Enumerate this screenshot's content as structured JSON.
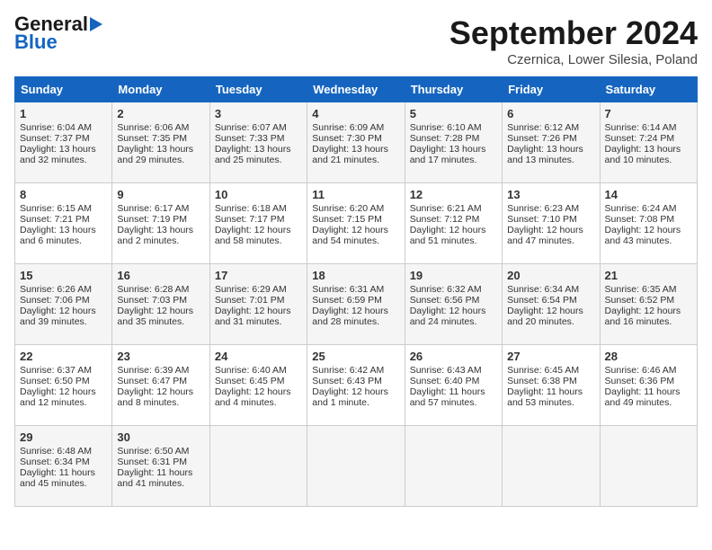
{
  "header": {
    "logo_line1": "General",
    "logo_line2": "Blue",
    "month_title": "September 2024",
    "subtitle": "Czernica, Lower Silesia, Poland"
  },
  "days_of_week": [
    "Sunday",
    "Monday",
    "Tuesday",
    "Wednesday",
    "Thursday",
    "Friday",
    "Saturday"
  ],
  "weeks": [
    [
      {
        "day": 1,
        "sunrise": "6:04 AM",
        "sunset": "7:37 PM",
        "daylight": "13 hours and 32 minutes."
      },
      {
        "day": 2,
        "sunrise": "6:06 AM",
        "sunset": "7:35 PM",
        "daylight": "13 hours and 29 minutes."
      },
      {
        "day": 3,
        "sunrise": "6:07 AM",
        "sunset": "7:33 PM",
        "daylight": "13 hours and 25 minutes."
      },
      {
        "day": 4,
        "sunrise": "6:09 AM",
        "sunset": "7:30 PM",
        "daylight": "13 hours and 21 minutes."
      },
      {
        "day": 5,
        "sunrise": "6:10 AM",
        "sunset": "7:28 PM",
        "daylight": "13 hours and 17 minutes."
      },
      {
        "day": 6,
        "sunrise": "6:12 AM",
        "sunset": "7:26 PM",
        "daylight": "13 hours and 13 minutes."
      },
      {
        "day": 7,
        "sunrise": "6:14 AM",
        "sunset": "7:24 PM",
        "daylight": "13 hours and 10 minutes."
      }
    ],
    [
      {
        "day": 8,
        "sunrise": "6:15 AM",
        "sunset": "7:21 PM",
        "daylight": "13 hours and 6 minutes."
      },
      {
        "day": 9,
        "sunrise": "6:17 AM",
        "sunset": "7:19 PM",
        "daylight": "13 hours and 2 minutes."
      },
      {
        "day": 10,
        "sunrise": "6:18 AM",
        "sunset": "7:17 PM",
        "daylight": "12 hours and 58 minutes."
      },
      {
        "day": 11,
        "sunrise": "6:20 AM",
        "sunset": "7:15 PM",
        "daylight": "12 hours and 54 minutes."
      },
      {
        "day": 12,
        "sunrise": "6:21 AM",
        "sunset": "7:12 PM",
        "daylight": "12 hours and 51 minutes."
      },
      {
        "day": 13,
        "sunrise": "6:23 AM",
        "sunset": "7:10 PM",
        "daylight": "12 hours and 47 minutes."
      },
      {
        "day": 14,
        "sunrise": "6:24 AM",
        "sunset": "7:08 PM",
        "daylight": "12 hours and 43 minutes."
      }
    ],
    [
      {
        "day": 15,
        "sunrise": "6:26 AM",
        "sunset": "7:06 PM",
        "daylight": "12 hours and 39 minutes."
      },
      {
        "day": 16,
        "sunrise": "6:28 AM",
        "sunset": "7:03 PM",
        "daylight": "12 hours and 35 minutes."
      },
      {
        "day": 17,
        "sunrise": "6:29 AM",
        "sunset": "7:01 PM",
        "daylight": "12 hours and 31 minutes."
      },
      {
        "day": 18,
        "sunrise": "6:31 AM",
        "sunset": "6:59 PM",
        "daylight": "12 hours and 28 minutes."
      },
      {
        "day": 19,
        "sunrise": "6:32 AM",
        "sunset": "6:56 PM",
        "daylight": "12 hours and 24 minutes."
      },
      {
        "day": 20,
        "sunrise": "6:34 AM",
        "sunset": "6:54 PM",
        "daylight": "12 hours and 20 minutes."
      },
      {
        "day": 21,
        "sunrise": "6:35 AM",
        "sunset": "6:52 PM",
        "daylight": "12 hours and 16 minutes."
      }
    ],
    [
      {
        "day": 22,
        "sunrise": "6:37 AM",
        "sunset": "6:50 PM",
        "daylight": "12 hours and 12 minutes."
      },
      {
        "day": 23,
        "sunrise": "6:39 AM",
        "sunset": "6:47 PM",
        "daylight": "12 hours and 8 minutes."
      },
      {
        "day": 24,
        "sunrise": "6:40 AM",
        "sunset": "6:45 PM",
        "daylight": "12 hours and 4 minutes."
      },
      {
        "day": 25,
        "sunrise": "6:42 AM",
        "sunset": "6:43 PM",
        "daylight": "12 hours and 1 minute."
      },
      {
        "day": 26,
        "sunrise": "6:43 AM",
        "sunset": "6:40 PM",
        "daylight": "11 hours and 57 minutes."
      },
      {
        "day": 27,
        "sunrise": "6:45 AM",
        "sunset": "6:38 PM",
        "daylight": "11 hours and 53 minutes."
      },
      {
        "day": 28,
        "sunrise": "6:46 AM",
        "sunset": "6:36 PM",
        "daylight": "11 hours and 49 minutes."
      }
    ],
    [
      {
        "day": 29,
        "sunrise": "6:48 AM",
        "sunset": "6:34 PM",
        "daylight": "11 hours and 45 minutes."
      },
      {
        "day": 30,
        "sunrise": "6:50 AM",
        "sunset": "6:31 PM",
        "daylight": "11 hours and 41 minutes."
      },
      null,
      null,
      null,
      null,
      null
    ]
  ]
}
